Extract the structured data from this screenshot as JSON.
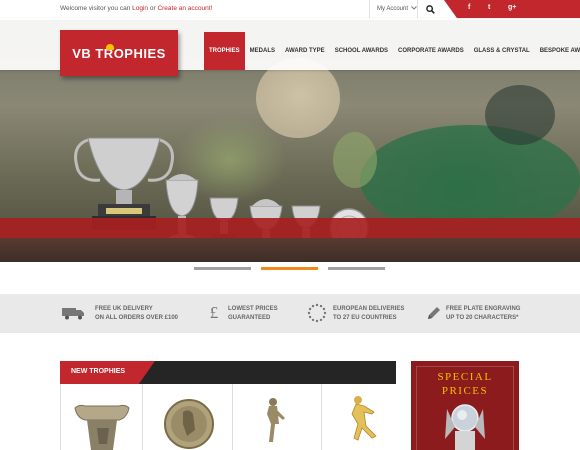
{
  "topbar": {
    "welcome_prefix": "Welcome visitor you can",
    "login": "Login",
    "or": "or",
    "create_account": "Create an account!",
    "my_account": "My Account",
    "social": [
      "f",
      "t",
      "g+"
    ]
  },
  "logo": {
    "text": "VB  TROPHIES"
  },
  "nav": {
    "items": [
      "TROPHIES",
      "MEDALS",
      "AWARD TYPE",
      "SCHOOL AWARDS",
      "CORPORATE AWARDS",
      "GLASS & CRYSTAL",
      "BESPOKE AWARDS"
    ],
    "active_index": 0
  },
  "slider": {
    "slides": 3,
    "active_index": 1
  },
  "features": [
    {
      "icon": "truck-icon",
      "line1": "FREE UK DELIVERY",
      "line2": "ON ALL ORDERS OVER £100"
    },
    {
      "icon": "pound-icon",
      "line1": "LOWEST PRICES",
      "line2": "GUARANTEED"
    },
    {
      "icon": "eu-stars-icon",
      "line1": "EUROPEAN DELIVERIES",
      "line2": "TO 27 EU COUNTRIES"
    },
    {
      "icon": "pen-icon",
      "line1": "FREE PLATE ENGRAVING",
      "line2": "UP TO 20 CHARACTERS*"
    }
  ],
  "new_trophies": {
    "title": "NEW TROPHIES"
  },
  "special": {
    "line1": "SPECIAL",
    "line2": "PRICES"
  },
  "colors": {
    "brand_red": "#c1272d",
    "slider_active": "#f08a1c",
    "special_gold": "#f2c200"
  }
}
